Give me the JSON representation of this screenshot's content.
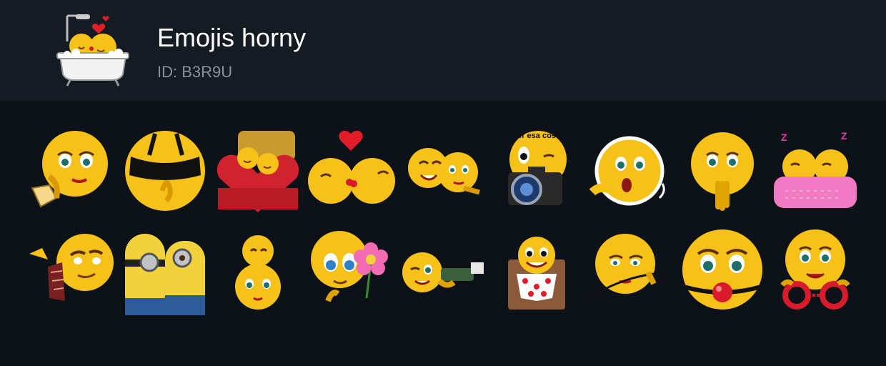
{
  "pack": {
    "title": "Emojis horny",
    "id_text": "ID: B3R9U"
  },
  "colors": {
    "background": "#0d1219",
    "header_background": "#151b23",
    "title": "#ffffff",
    "id": "#8a9199",
    "emoji_yellow": "#f6c21a"
  },
  "stickers": [
    {
      "icon": "flirty-wink-emoji-icon"
    },
    {
      "icon": "blindfold-emoji-icon"
    },
    {
      "icon": "heart-bed-couple-icon"
    },
    {
      "icon": "kissing-couple-heart-icon"
    },
    {
      "icon": "hugging-couple-emoji-icon"
    },
    {
      "icon": "camera-emoji-icon",
      "caption": "ver esa cosa"
    },
    {
      "icon": "surprised-emoji-sticker-icon"
    },
    {
      "icon": "shy-finger-biting-emoji-icon"
    },
    {
      "icon": "sleeping-couple-blanket-icon"
    },
    {
      "icon": "waving-handkerchief-emoji-icon"
    },
    {
      "icon": "minions-kiss-icon"
    },
    {
      "icon": "stacked-emoji-couple-icon"
    },
    {
      "icon": "flower-giving-emoji-icon"
    },
    {
      "icon": "lying-winking-emoji-icon"
    },
    {
      "icon": "heart-boxers-emoji-icon"
    },
    {
      "icon": "whip-emoji-icon"
    },
    {
      "icon": "ball-gag-emoji-icon"
    },
    {
      "icon": "handcuffs-emoji-icon"
    }
  ]
}
